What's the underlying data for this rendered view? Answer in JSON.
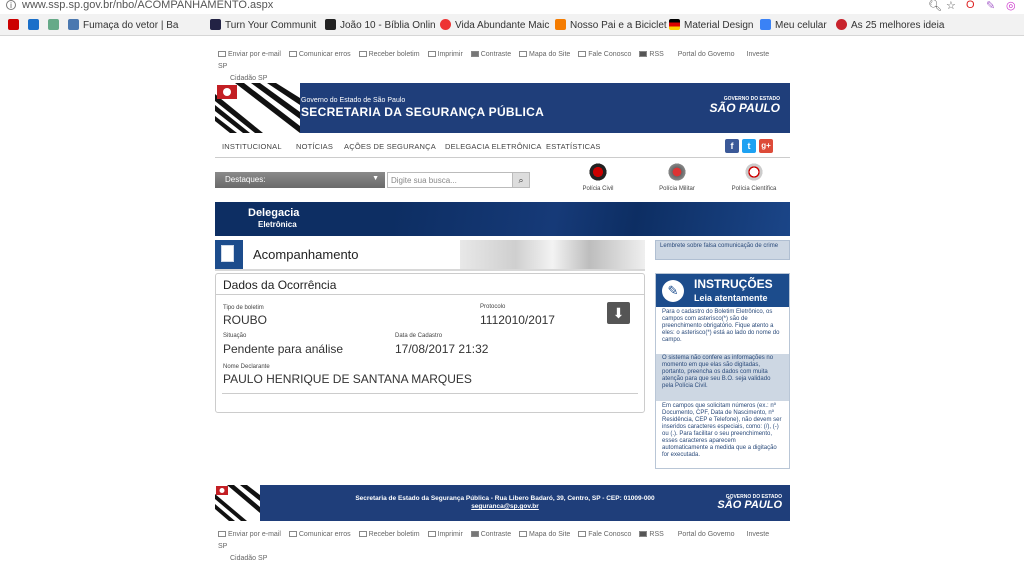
{
  "browser": {
    "url": "www.ssp.sp.gov.br/nbo/ACOMPANHAMENTO.aspx",
    "bookmarks": [
      "Fumaça do vetor | Ba",
      "Turn Your Communit",
      "João 10 - Bíblia Onlin",
      "Vida Abundante Maic",
      "Nosso Pai e a Biciclet",
      "Material Design",
      "Meu celular",
      "As 25 melhores ideia"
    ]
  },
  "util_links": {
    "email": "Enviar por e-mail",
    "erros": "Comunicar erros",
    "boletim": "Receber boletim",
    "imprimir": "Imprimir",
    "contraste": "Contraste",
    "mapa": "Mapa do Site",
    "fale": "Fale Conosco",
    "rss": "RSS",
    "portal": "Portal do Governo",
    "investe": "Investe SP",
    "cidadao": "Cidadão SP"
  },
  "header": {
    "subtitle": "Governo do Estado de São Paulo",
    "title": "SECRETARIA DA SEGURANÇA PÚBLICA",
    "logo_small": "GOVERNO DO ESTADO",
    "logo_big": "SÃO PAULO"
  },
  "nav": [
    "INSTITUCIONAL",
    "NOTÍCIAS",
    "AÇÕES DE SEGURANÇA",
    "DELEGACIA ELETRÔNICA",
    "ESTATÍSTICAS"
  ],
  "search": {
    "destaques": "Destaques:",
    "placeholder": "Digite sua busca..."
  },
  "policias": [
    "Polícia Civil",
    "Polícia Militar",
    "Polícia Científica"
  ],
  "delegacia": {
    "line1": "Delegacia",
    "line2": "Eletrônica"
  },
  "page_title": "Acompanhamento",
  "ocorrencia": {
    "title": "Dados da Ocorrência",
    "tipo_label": "Tipo de boletim",
    "tipo_value": "ROUBO",
    "protocolo_label": "Protocolo",
    "protocolo_value": "1112010/2017",
    "situacao_label": "Situação",
    "situacao_value": "Pendente para análise",
    "data_label": "Data de Cadastro",
    "data_value": "17/08/2017 21:32",
    "nome_label": "Nome Declarante",
    "nome_value": "PAULO HENRIQUE DE SANTANA MARQUES"
  },
  "lembrete": "Lembrete sobre falsa comunicação de crime",
  "instrucoes": {
    "title": "INSTRUÇÕES",
    "subtitle": "Leia atentamente",
    "blocks": [
      "Para o cadastro do Boletim Eletrônico, os campos com asterisco(*) são de preenchimento obrigatório. Fique atento a eles: o asterisco(*) está ao lado do nome do campo.",
      "O sistema não confere as informações no momento em que elas são digitadas, portanto, preencha os dados com muita atenção para que seu B.O. seja validado pela Polícia Civil.",
      "Em campos que solicitam números (ex.: nº Documento, CPF, Data de Nascimento, nº Residência, CEP e Telefone), não devem ser inseridos caracteres especiais, como: (/), (-) ou (.). Para facilitar o seu preenchimento, esses caracteres aparecem automaticamente a medida que a digitação for executada."
    ]
  },
  "footer": {
    "address": "Secretaria de Estado da Segurança Pública - Rua Libero Badaró, 39, Centro, SP - CEP: 01009-000",
    "email": "seguranca@sp.gov.br"
  },
  "colors": {
    "navy": "#1f3e7a",
    "dark_navy": "#0d2e63",
    "accent_blue": "#1c4c8c"
  }
}
